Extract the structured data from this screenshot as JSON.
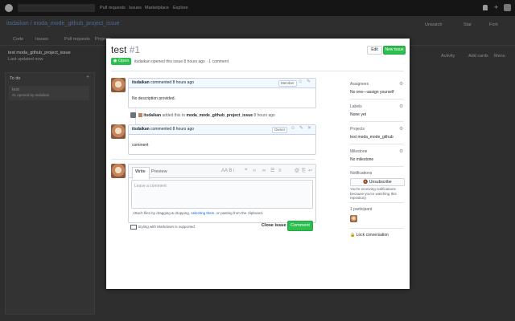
{
  "background": {
    "nav_items": [
      "Pull requests",
      "Issues",
      "Marketplace",
      "Explore"
    ],
    "repo_path": "itsdaikan / moda_mode_github_project_issue",
    "repo_tabs": [
      "Code",
      "Issues",
      "Pull requests",
      "Projects"
    ],
    "right_tabs": [
      "Unwatch",
      "Star",
      "Fork"
    ],
    "project_title": "test moda_github_project_issue",
    "project_subtitle": "Last updated now",
    "column_title": "To do",
    "column_item": "test",
    "column_item_sub": "#1 opened by itsdaikan",
    "board_actions": [
      "Activity",
      "Add cards",
      "Menu"
    ]
  },
  "issue": {
    "title": "test",
    "number": "#1",
    "state": "Open",
    "meta": "itsdaikan opened this issue 8 hours ago · 1 comment",
    "edit_label": "Edit",
    "new_issue_label": "New issue"
  },
  "comments": [
    {
      "author": "itsdaikan",
      "header": "commented 8 hours ago",
      "tag": "Member",
      "body": "No description provided."
    },
    {
      "author": "itsdaikan",
      "header": "commented 8 hours ago",
      "tag": "Owner",
      "body": "comment"
    }
  ],
  "event": {
    "author": "itsdaikan",
    "text": "added this to",
    "target": "moda_mode_github_project_issue",
    "suffix": "8 hours ago"
  },
  "composer": {
    "tab_write": "Write",
    "tab_preview": "Preview",
    "toolbar_label": "AA B i",
    "placeholder": "Leave a comment",
    "hint_prefix": "Attach files by dragging & dropping,",
    "hint_link": "selecting them",
    "hint_suffix": ", or pasting from the clipboard.",
    "markdown_note": "Styling with Markdown is supported",
    "close_label": "Close issue",
    "comment_label": "Comment"
  },
  "sidebar": {
    "assignees_label": "Assignees",
    "assignees_value": "No one—assign yourself",
    "labels_label": "Labels",
    "labels_value": "None yet",
    "projects_label": "Projects",
    "projects_value": "test moda_mode_github",
    "milestone_label": "Milestone",
    "milestone_value": "No milestone",
    "notifications_label": "Notifications",
    "unsubscribe_label": "Unsubscribe",
    "notifications_note": "You're receiving notifications because you're watching this repository.",
    "participants_label": "1 participant",
    "lock_label": "Lock conversation"
  }
}
